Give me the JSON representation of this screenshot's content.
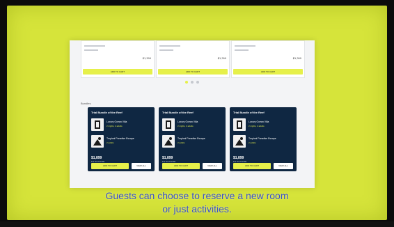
{
  "top_cards": [
    {
      "price": "$1,399",
      "button": "ADD TO CART"
    },
    {
      "price": "$1,399",
      "button": "ADD TO CART"
    },
    {
      "price": "$1,399",
      "button": "ADD TO CART"
    }
  ],
  "carousel": {
    "pages": 3,
    "active": 0
  },
  "section_label": "Bundles",
  "bundles": [
    {
      "title": "Trial Bundle of the Reef",
      "items": [
        {
          "name": "Luxury Ocean Villa",
          "sub": "2 nights, 2 adults"
        },
        {
          "name": "Tropical Paradise Escape",
          "sub": "2 adults"
        }
      ],
      "total": "$1,899",
      "total_sub": "For the bundle",
      "add_label": "ADD TO CART",
      "view_label": "VIEW ALL"
    },
    {
      "title": "Trial Bundle of the Reef",
      "items": [
        {
          "name": "Luxury Ocean Villa",
          "sub": "2 nights, 2 adults"
        },
        {
          "name": "Tropical Paradise Escape",
          "sub": "2 adults"
        }
      ],
      "total": "$1,899",
      "total_sub": "For the bundle",
      "add_label": "ADD TO CART",
      "view_label": "VIEW ALL"
    },
    {
      "title": "Trial Bundle of the Reef",
      "items": [
        {
          "name": "Luxury Ocean Villa",
          "sub": "2 nights, 2 adults"
        },
        {
          "name": "Tropical Paradise Escape",
          "sub": "2 adults"
        }
      ],
      "total": "$1,899",
      "total_sub": "For the bundle",
      "add_label": "ADD TO CART",
      "view_label": "VIEW ALL"
    }
  ],
  "subtitle": {
    "line1": "Guests can choose to reserve a new room",
    "line2": "or just activities."
  },
  "colors": {
    "accent": "#e6f04a",
    "card_dark": "#0f2742",
    "backdrop": "#d6e43a"
  }
}
